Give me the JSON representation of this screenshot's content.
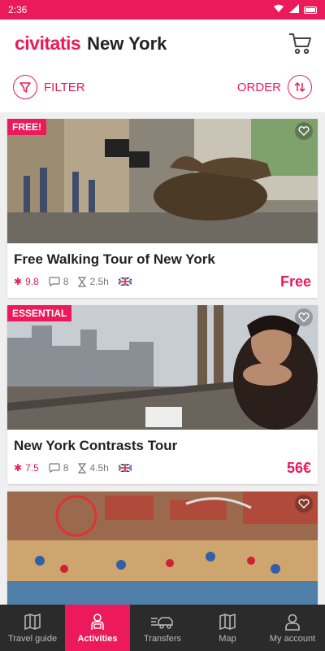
{
  "status": {
    "time": "2:36"
  },
  "header": {
    "logo": "civitatis",
    "city": "New York"
  },
  "toolbar": {
    "filter_label": "FILTER",
    "order_label": "ORDER"
  },
  "cards": [
    {
      "tag": "FREE!",
      "title": "Free Walking Tour of New York",
      "rating": "9.8",
      "comments": "8",
      "duration": "2.5h",
      "price": "Free"
    },
    {
      "tag": "ESSENTIAL",
      "title": "New York Contrasts Tour",
      "rating": "7.5",
      "comments": "8",
      "duration": "4.5h",
      "price": "56€"
    },
    {
      "tag": "",
      "title": "",
      "rating": "",
      "comments": "",
      "duration": "",
      "price": ""
    }
  ],
  "tabs": [
    {
      "label": "Travel guide",
      "icon": "map-book-icon",
      "active": false
    },
    {
      "label": "Activities",
      "icon": "person-icon",
      "active": true
    },
    {
      "label": "Transfers",
      "icon": "transfer-car-icon",
      "active": false
    },
    {
      "label": "Map",
      "icon": "map-icon",
      "active": false
    },
    {
      "label": "My account",
      "icon": "user-icon",
      "active": false
    }
  ],
  "colors": {
    "brand": "#ec1a5a",
    "tabbar": "#2b2b2b"
  }
}
